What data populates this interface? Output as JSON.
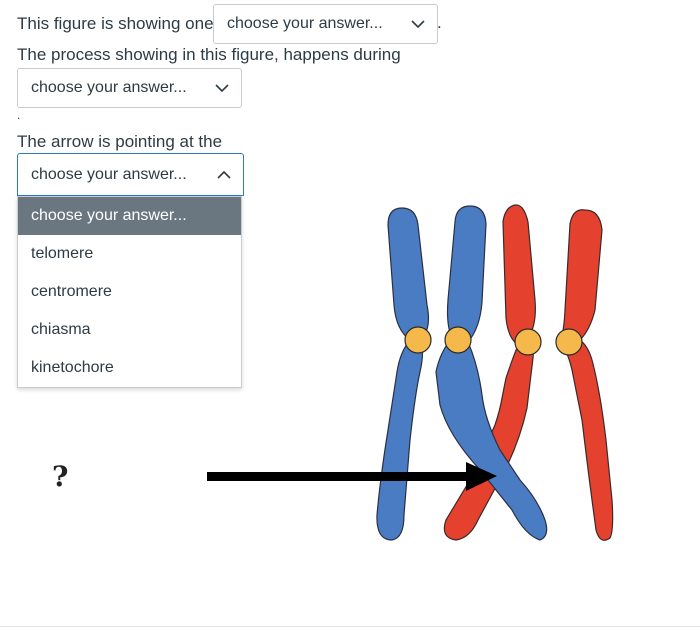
{
  "questions": {
    "q1_text": "This figure is showing one",
    "q1_value": "choose your answer...",
    "q2_text": "The process showing in this figure, happens during",
    "q2_value": "choose your answer...",
    "q3_text": "The arrow is pointing at the",
    "q3_value": "choose your answer...",
    "punct_period": ".",
    "punct_dot": "."
  },
  "dropdown": {
    "options": [
      "choose your answer...",
      "telomere",
      "centromere",
      "chiasma",
      "kinetochore"
    ],
    "highlighted_index": 0
  },
  "figure": {
    "question_mark": "?",
    "colors": {
      "blue": "#4a7cc4",
      "red": "#e5412f",
      "centromere": "#f4b94a",
      "arrow": "#000000"
    }
  }
}
